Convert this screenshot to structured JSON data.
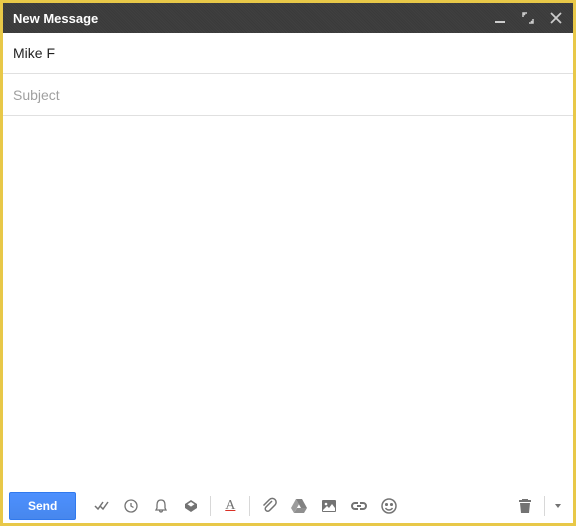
{
  "header": {
    "title": "New Message",
    "minimize": "Minimize",
    "expand": "Full screen",
    "close": "Close"
  },
  "recipients": {
    "to_value": "Mike F"
  },
  "subject": {
    "placeholder": "Subject",
    "value": ""
  },
  "body": {
    "content": ""
  },
  "footer": {
    "send_label": "Send",
    "tools": {
      "spellcheck": "Spell check",
      "schedule": "Schedule send",
      "snooze": "Snooze",
      "templates": "Templates",
      "formatting": "Formatting options",
      "attach": "Attach files",
      "drive": "Insert from Drive",
      "photo": "Insert photo",
      "link": "Insert link",
      "emoji": "Insert emoji",
      "discard": "Discard draft",
      "more": "More options"
    }
  }
}
